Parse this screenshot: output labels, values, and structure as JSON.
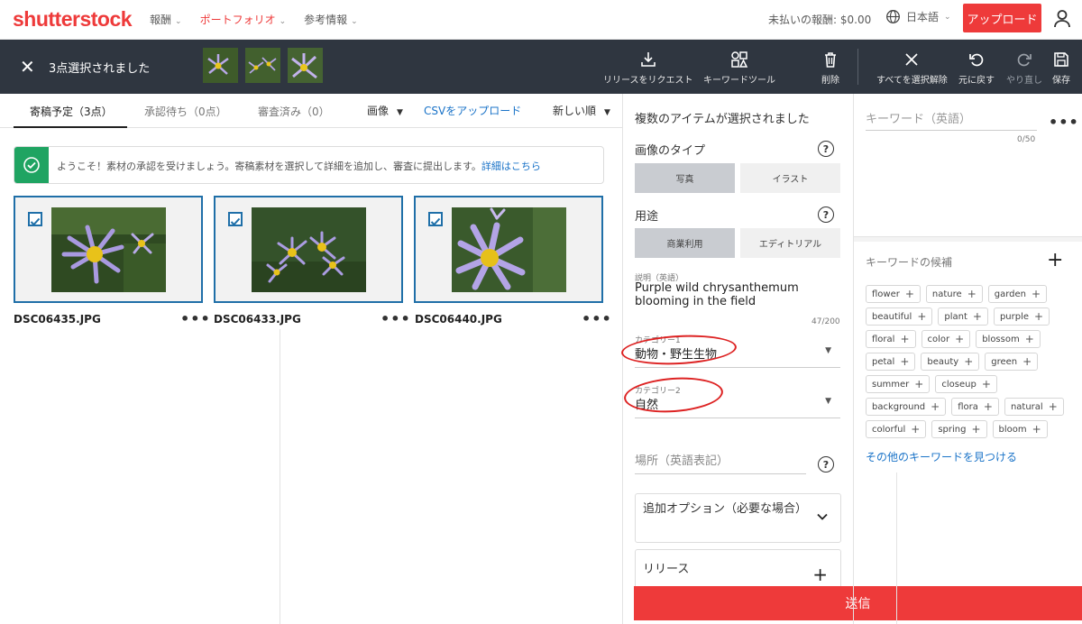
{
  "header": {
    "logo": "shutterstock",
    "nav": [
      {
        "label": "報酬",
        "active": false
      },
      {
        "label": "ポートフォリオ",
        "active": true
      },
      {
        "label": "参考情報",
        "active": false
      }
    ],
    "earnings": "未払いの報酬: $0.00",
    "language": "日本語",
    "upload": "アップロード"
  },
  "selection_bar": {
    "title": "3点選択されました",
    "tools": {
      "request_release": "リリースをリクエスト",
      "keyword_tool": "キーワードツール",
      "delete": "削除",
      "deselect_all": "すべてを選択解除",
      "undo": "元に戻す",
      "redo": "やり直し",
      "save": "保存"
    }
  },
  "tabs": {
    "pending": "寄稿予定（3点）",
    "awaiting": "承認待ち（0点）",
    "reviewed": "審査済み（0）",
    "media_filter": "画像",
    "csv": "CSVをアップロード",
    "sort": "新しい順"
  },
  "welcome": {
    "text": "ようこそ！素材の承認を受けましょう。寄稿素材を選択して詳細を追加し、審査に提出します。",
    "link": "詳細はこちら"
  },
  "items": [
    {
      "filename": "DSC06435.JPG"
    },
    {
      "filename": "DSC06433.JPG"
    },
    {
      "filename": "DSC06440.JPG"
    }
  ],
  "details": {
    "header": "複数のアイテムが選択されました",
    "image_type_label": "画像のタイプ",
    "image_type_options": [
      "写真",
      "イラスト"
    ],
    "usage_label": "用途",
    "usage_options": [
      "商業利用",
      "エディトリアル"
    ],
    "description_label": "説明（英語）",
    "description": "Purple wild chrysanthemum blooming in the field",
    "description_count": "47/200",
    "category1_label": "カテゴリー1",
    "category1_value": "動物・野生生物",
    "category2_label": "カテゴリー2",
    "category2_value": "自然",
    "location_placeholder": "場所（英語表記）",
    "additional_options": "追加オプション（必要な場合）",
    "release": "リリース",
    "submit": "送信"
  },
  "keywords": {
    "input_placeholder": "キーワード（英語）",
    "count": "0/50",
    "suggestions_title": "キーワードの候補",
    "suggestions": [
      "flower",
      "nature",
      "garden",
      "beautiful",
      "plant",
      "purple",
      "floral",
      "color",
      "blossom",
      "petal",
      "beauty",
      "green",
      "summer",
      "closeup",
      "background",
      "flora",
      "natural",
      "colorful",
      "spring",
      "bloom"
    ],
    "more_link": "その他のキーワードを見つける"
  },
  "colors": {
    "brand_red": "#ee3a3a",
    "dark_bar": "#2f3640",
    "accent_blue": "#1a73c8",
    "success_green": "#1fa462"
  }
}
